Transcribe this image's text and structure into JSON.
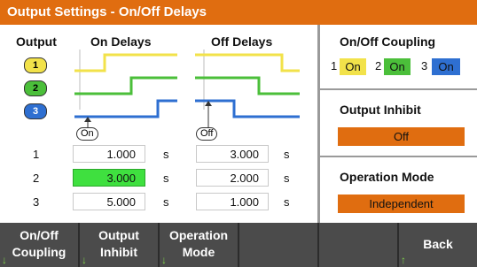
{
  "title": "Output Settings - On/Off Delays",
  "columns": {
    "output": "Output",
    "on_delays": "On Delays",
    "off_delays": "Off Delays"
  },
  "outputs": [
    {
      "label": "1",
      "color": "#f2e24a"
    },
    {
      "label": "2",
      "color": "#4bbf3a"
    },
    {
      "label": "3",
      "color": "#2e6fd1"
    }
  ],
  "on_button": "On",
  "off_button": "Off",
  "rows": [
    {
      "num": "1",
      "on_delay": "1.000",
      "on_unit": "s",
      "off_delay": "3.000",
      "off_unit": "s"
    },
    {
      "num": "2",
      "on_delay": "3.000",
      "on_unit": "s",
      "off_delay": "2.000",
      "off_unit": "s"
    },
    {
      "num": "3",
      "on_delay": "5.000",
      "on_unit": "s",
      "off_delay": "1.000",
      "off_unit": "s"
    }
  ],
  "coupling": {
    "title": "On/Off Coupling",
    "items": [
      {
        "num": "1",
        "state": "On",
        "color": "#f2e24a"
      },
      {
        "num": "2",
        "state": "On",
        "color": "#4bbf3a"
      },
      {
        "num": "3",
        "state": "On",
        "color": "#2e6fd1"
      }
    ]
  },
  "inhibit": {
    "title": "Output Inhibit",
    "value": "Off"
  },
  "operation_mode": {
    "title": "Operation Mode",
    "value": "Independent"
  },
  "softkeys": [
    {
      "line1": "On/Off",
      "line2": "Coupling",
      "arrow": "↓"
    },
    {
      "line1": "Output",
      "line2": "Inhibit",
      "arrow": "↓"
    },
    {
      "line1": "Operation",
      "line2": "Mode",
      "arrow": "↓"
    },
    {
      "line1": "",
      "line2": ""
    },
    {
      "line1": "",
      "line2": ""
    },
    {
      "line1": "Back",
      "line2": "",
      "arrow": "↑"
    }
  ],
  "colors": {
    "accent": "#e06d10",
    "highlight_field": "#3fe03f",
    "softkey_bg": "#4b4b4b"
  }
}
